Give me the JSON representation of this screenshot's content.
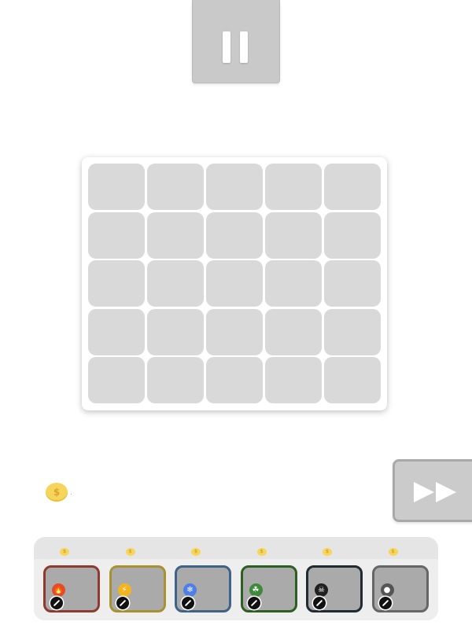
{
  "pause_button": {
    "icon": "pause-icon"
  },
  "fast_forward_button": {
    "icon": "fast-forward-icon"
  },
  "board": {
    "rows": 5,
    "columns": 5
  },
  "currency": {
    "icon": "coin-icon",
    "symbol": "$",
    "amount": ".",
    "color": "#f7d55a"
  },
  "shop": {
    "slots": [
      {
        "element": "fire",
        "icon": "fire-icon",
        "glyph": "🔥",
        "price_symbol": "$",
        "border_color": "#8f3a2f",
        "badge_color": "#e64a28"
      },
      {
        "element": "lightning",
        "icon": "lightning-icon",
        "glyph": "⚡",
        "price_symbol": "$",
        "border_color": "#a89131",
        "badge_color": "#f2b51f"
      },
      {
        "element": "ice",
        "icon": "snowflake-icon",
        "glyph": "❄",
        "price_symbol": "$",
        "border_color": "#3f6288",
        "badge_color": "#4f7fe6"
      },
      {
        "element": "poison",
        "icon": "poison-icon",
        "glyph": "☘",
        "price_symbol": "$",
        "border_color": "#2e5f22",
        "badge_color": "#3e8a3c"
      },
      {
        "element": "skull",
        "icon": "skull-icon",
        "glyph": "☠",
        "price_symbol": "$",
        "border_color": "#202a33",
        "badge_color": "#202020"
      },
      {
        "element": "bullet",
        "icon": "bullet-icon",
        "glyph": "●",
        "price_symbol": "$",
        "border_color": "#666666",
        "badge_color": "#555555"
      }
    ]
  }
}
